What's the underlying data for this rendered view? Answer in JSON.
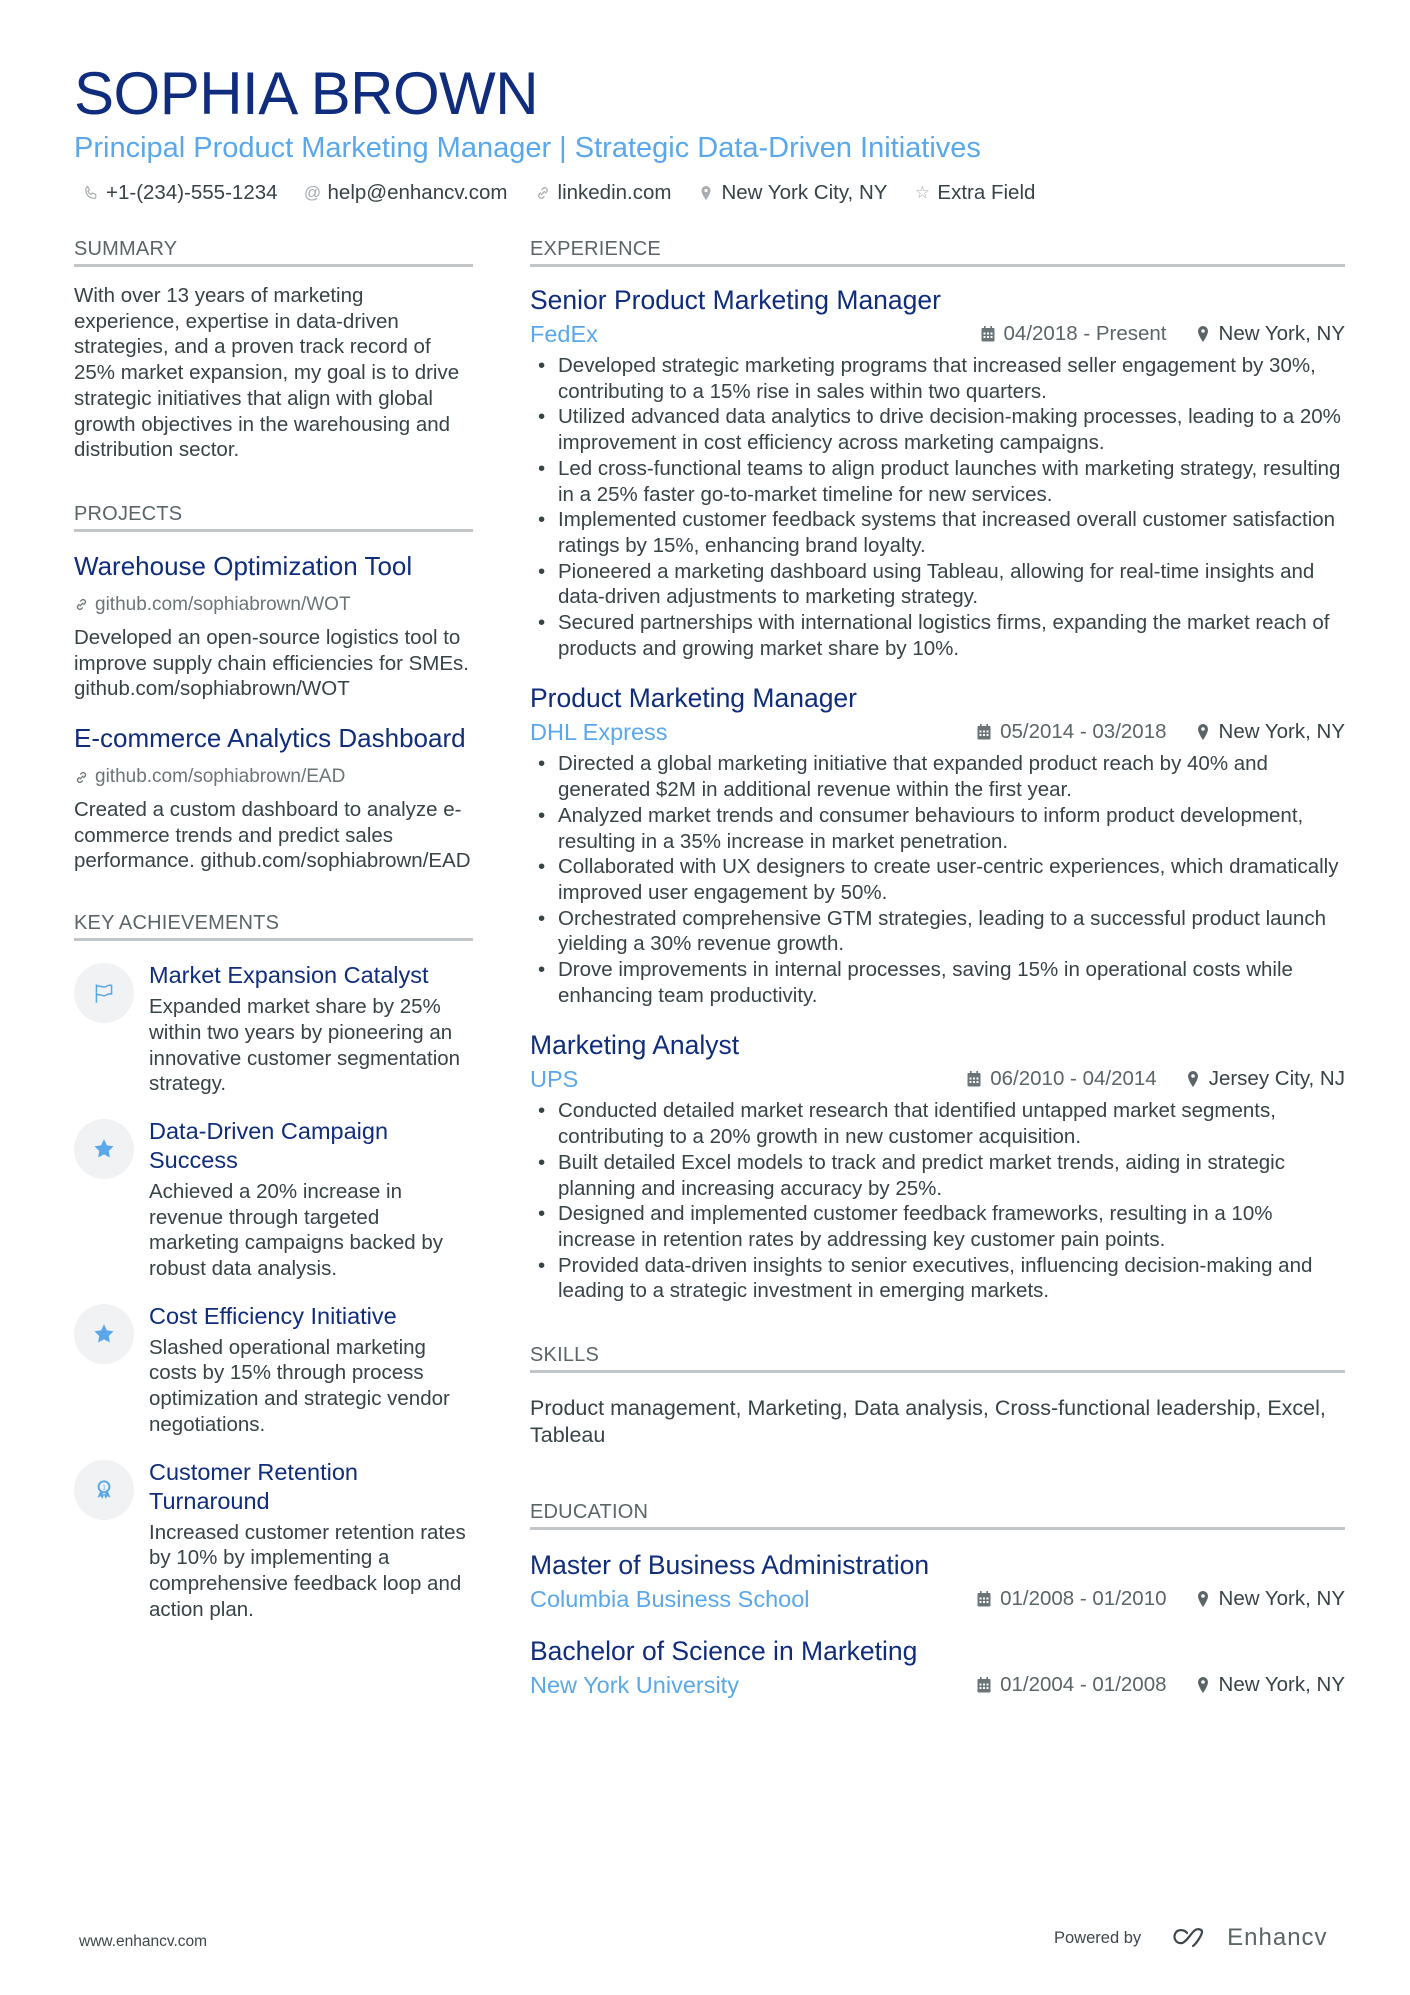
{
  "header": {
    "name": "SOPHIA BROWN",
    "subtitle": "Principal Product Marketing Manager | Strategic Data-Driven Initiatives",
    "contacts": [
      {
        "icon": "phone-icon",
        "text": "+1-(234)-555-1234"
      },
      {
        "icon": "at-icon",
        "text": "help@enhancv.com"
      },
      {
        "icon": "link-icon",
        "text": "linkedin.com"
      },
      {
        "icon": "location-pin-icon",
        "text": "New York City, NY"
      },
      {
        "icon": "star-outline-icon",
        "text": "Extra Field"
      }
    ]
  },
  "colors": {
    "name": "#0f2d7c",
    "accent": "#5aa8ea",
    "text": "#384347",
    "divider": "#c3c6c9"
  },
  "summary": {
    "title": "SUMMARY",
    "text": "With over 13 years of marketing experience, expertise in data-driven strategies, and a proven track record of 25% market expansion, my goal is to drive strategic initiatives that align with global growth objectives in the warehousing and distribution sector."
  },
  "projects": {
    "title": "PROJECTS",
    "items": [
      {
        "title": "Warehouse Optimization Tool",
        "link": "github.com/sophiabrown/WOT",
        "description": "Developed an open-source logistics tool to improve supply chain efficiencies for SMEs. github.com/sophiabrown/WOT"
      },
      {
        "title": "E-commerce Analytics Dashboard",
        "link": "github.com/sophiabrown/EAD",
        "description": "Created a custom dashboard to analyze e-commerce trends and predict sales performance. github.com/sophiabrown/EAD"
      }
    ]
  },
  "achievements": {
    "title": "KEY ACHIEVEMENTS",
    "items": [
      {
        "icon": "flag-icon",
        "title": "Market Expansion Catalyst",
        "description": "Expanded market share by 25% within two years by pioneering an innovative customer segmentation strategy."
      },
      {
        "icon": "star-icon",
        "title": "Data-Driven Campaign Success",
        "description": "Achieved a 20% increase in revenue through targeted marketing campaigns backed by robust data analysis."
      },
      {
        "icon": "star-icon",
        "title": "Cost Efficiency Initiative",
        "description": "Slashed operational marketing costs by 15% through process optimization and strategic vendor negotiations."
      },
      {
        "icon": "award-ribbon-icon",
        "title": "Customer Retention Turnaround",
        "description": "Increased customer retention rates by 10% by implementing a comprehensive feedback loop and action plan."
      }
    ]
  },
  "experience": {
    "title": "EXPERIENCE",
    "jobs": [
      {
        "title": "Senior Product Marketing Manager",
        "company": "FedEx",
        "dates": "04/2018 - Present",
        "location": "New York, NY",
        "bullets": [
          "Developed strategic marketing programs that increased seller engagement by 30%, contributing to a 15% rise in sales within two quarters.",
          "Utilized advanced data analytics to drive decision-making processes, leading to a 20% improvement in cost efficiency across marketing campaigns.",
          "Led cross-functional teams to align product launches with marketing strategy, resulting in a 25% faster go-to-market timeline for new services.",
          "Implemented customer feedback systems that increased overall customer satisfaction ratings by 15%, enhancing brand loyalty.",
          "Pioneered a marketing dashboard using Tableau, allowing for real-time insights and data-driven adjustments to marketing strategy.",
          "Secured partnerships with international logistics firms, expanding the market reach of products and growing market share by 10%."
        ]
      },
      {
        "title": "Product Marketing Manager",
        "company": "DHL Express",
        "dates": "05/2014 - 03/2018",
        "location": "New York, NY",
        "bullets": [
          "Directed a global marketing initiative that expanded product reach by 40% and generated $2M in additional revenue within the first year.",
          "Analyzed market trends and consumer behaviours to inform product development, resulting in a 35% increase in market penetration.",
          "Collaborated with UX designers to create user-centric experiences, which dramatically improved user engagement by 50%.",
          "Orchestrated comprehensive GTM strategies, leading to a successful product launch yielding a 30% revenue growth.",
          "Drove improvements in internal processes, saving 15% in operational costs while enhancing team productivity."
        ]
      },
      {
        "title": "Marketing Analyst",
        "company": "UPS",
        "dates": "06/2010 - 04/2014",
        "location": "Jersey City, NJ",
        "bullets": [
          "Conducted detailed market research that identified untapped market segments, contributing to a 20% growth in new customer acquisition.",
          "Built detailed Excel models to track and predict market trends, aiding in strategic planning and increasing accuracy by 25%.",
          "Designed and implemented customer feedback frameworks, resulting in a 10% increase in retention rates by addressing key customer pain points.",
          "Provided data-driven insights to senior executives, influencing decision-making and leading to a strategic investment in emerging markets."
        ]
      }
    ]
  },
  "skills": {
    "title": "SKILLS",
    "text": "Product management, Marketing, Data analysis, Cross-functional leadership, Excel, Tableau"
  },
  "education": {
    "title": "EDUCATION",
    "items": [
      {
        "degree": "Master of Business Administration",
        "school": "Columbia Business School",
        "dates": "01/2008 - 01/2010",
        "location": "New York, NY"
      },
      {
        "degree": "Bachelor of Science in Marketing",
        "school": "New York University",
        "dates": "01/2004 - 01/2008",
        "location": "New York, NY"
      }
    ]
  },
  "footer": {
    "website": "www.enhancv.com",
    "powered_by": "Powered by",
    "brand": "Enhancv"
  }
}
